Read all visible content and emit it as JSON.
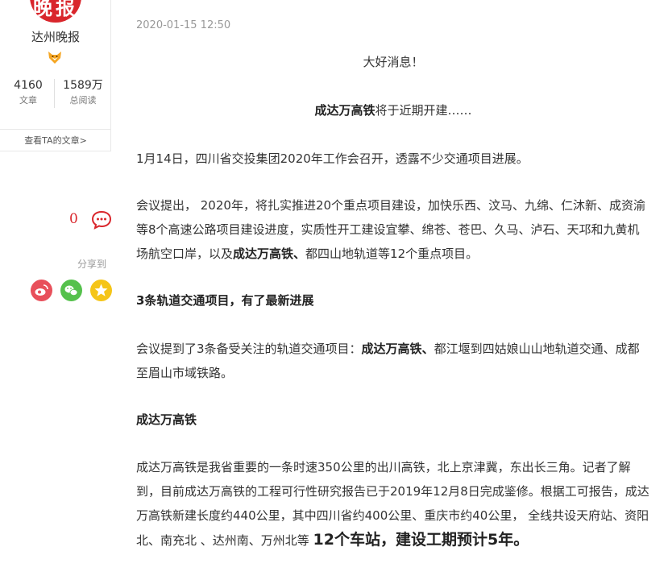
{
  "author": {
    "avatar_text": "晚报",
    "name": "达州晚报",
    "badge_icon": "fox-badge-icon",
    "stats": [
      {
        "value": "4160",
        "label": "文章"
      },
      {
        "value": "1589万",
        "label": "总阅读"
      }
    ],
    "view_articles": "查看TA的文章>"
  },
  "social": {
    "comment_count": "0",
    "share_label": "分享到",
    "share_targets": [
      "weibo-icon",
      "wechat-icon",
      "favorite-icon"
    ],
    "colors": {
      "weibo": "#e8505b",
      "wechat": "#55c14c",
      "favorite": "#f5c518",
      "accent": "#d9262c"
    }
  },
  "article": {
    "date": "2020-01-15 12:50",
    "p1": "大好消息！",
    "p2_bold": "成达万高铁",
    "p2_rest": "将于近期开建……",
    "p3": "1月14日，四川省交投集团2020年工作会召开，透露不少交通项目进展。",
    "p4_a": "会议提出， 2020年，将扎实推进20个重点项目建设，加快乐西、汶马、九绵、仁沐新、成资渝等8个高速公路项目建设进度，实质性开工建设宜攀、绵苍、苍巴、久马、泸石、天邛和九黄机场航空口岸，以及",
    "p4_bold": "成达万高铁、",
    "p4_c": "都四山地轨道等12个重点项目。",
    "h1": "3条轨道交通项目，有了最新进展",
    "p5_a": "会议提到了3条备受关注的轨道交通项目：",
    "p5_bold": "成达万高铁、",
    "p5_c": "都江堰到四姑娘山山地轨道交通、成都至眉山市域铁路。",
    "h2": "成达万高铁",
    "p6_a": "成达万高铁是我省重要的一条时速350公里的出川高铁，北上京津冀，东出长三角。记者了解到，目前成达万高铁的工程可行性研究报告已于2019年12月8日完成鉴修。根据工可报告，成达万高铁新建长度约440公里，其中四川省约400公里、重庆市约40公里， 全线共设天府站、资阳北、南充北 、达州南、万州北等 ",
    "p6_big": "12个车站，建设工期预计5年。"
  }
}
